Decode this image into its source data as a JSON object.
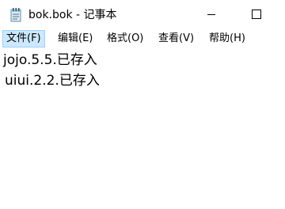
{
  "window": {
    "title": "bok.bok - 记事本"
  },
  "titlebar_icons": {
    "app": "notepad-icon",
    "minimize": "minimize-icon",
    "maximize": "maximize-icon"
  },
  "menu": {
    "file": "文件(F)",
    "edit": "编辑(E)",
    "format": "格式(O)",
    "view": "查看(V)",
    "help": "帮助(H)"
  },
  "document": {
    "lines": [
      "jojo.5.5.已存入",
      "uiui.2.2.已存入"
    ]
  },
  "colors": {
    "menu_active_bg": "#cce8ff",
    "menu_active_border": "#99d1ff"
  }
}
